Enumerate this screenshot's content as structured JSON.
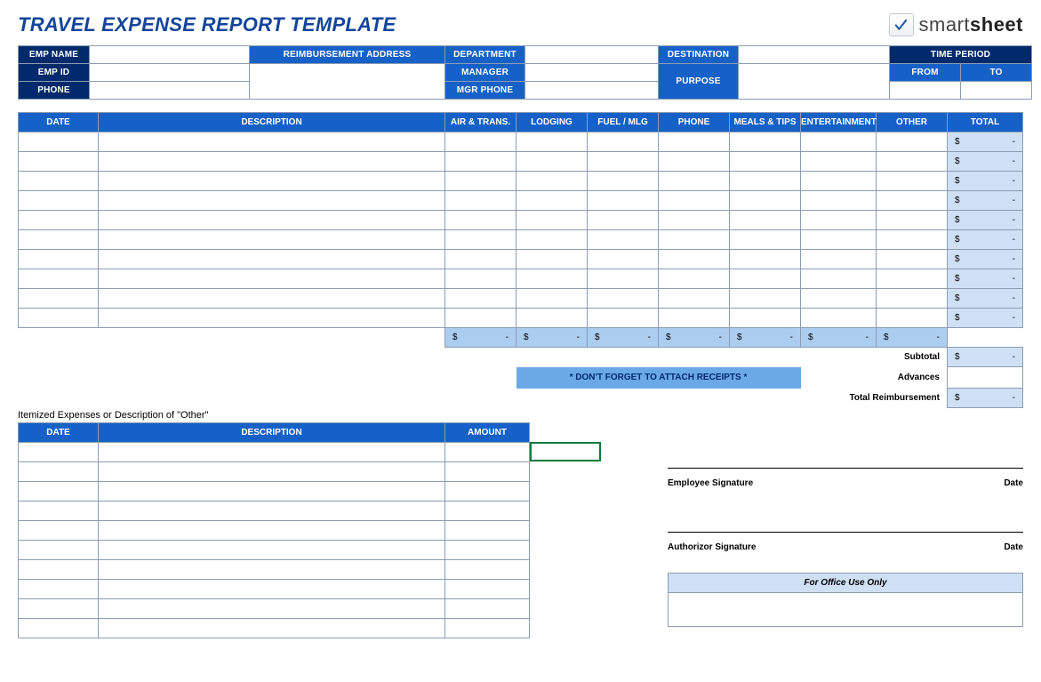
{
  "title": "TRAVEL EXPENSE REPORT TEMPLATE",
  "brand": {
    "name1": "smart",
    "name2": "sheet"
  },
  "info": {
    "emp_name": "EMP NAME",
    "reimb_addr": "REIMBURSEMENT ADDRESS",
    "department": "DEPARTMENT",
    "destination": "DESTINATION",
    "time_period": "TIME PERIOD",
    "emp_id": "EMP ID",
    "manager": "MANAGER",
    "purpose": "PURPOSE",
    "from": "FROM",
    "to": "TO",
    "phone": "PHONE",
    "mgr_phone": "MGR PHONE"
  },
  "exp_headers": [
    "DATE",
    "DESCRIPTION",
    "AIR & TRANS.",
    "LODGING",
    "FUEL / MLG",
    "PHONE",
    "MEALS & TIPS",
    "ENTERTAINMENT",
    "OTHER",
    "TOTAL"
  ],
  "exp_rows": 10,
  "money": {
    "sym": "$",
    "dash": "-"
  },
  "reminder": "* DON'T FORGET TO ATTACH RECEIPTS *",
  "summary": {
    "subtotal": "Subtotal",
    "advances": "Advances",
    "total_reimb": "Total Reimbursement"
  },
  "itemized": {
    "title": "Itemized Expenses or Description of \"Other\"",
    "headers": [
      "DATE",
      "DESCRIPTION",
      "AMOUNT"
    ],
    "rows": 10
  },
  "sig": {
    "emp": "Employee Signature",
    "auth": "Authorizor Signature",
    "date": "Date"
  },
  "office": "For Office Use Only"
}
